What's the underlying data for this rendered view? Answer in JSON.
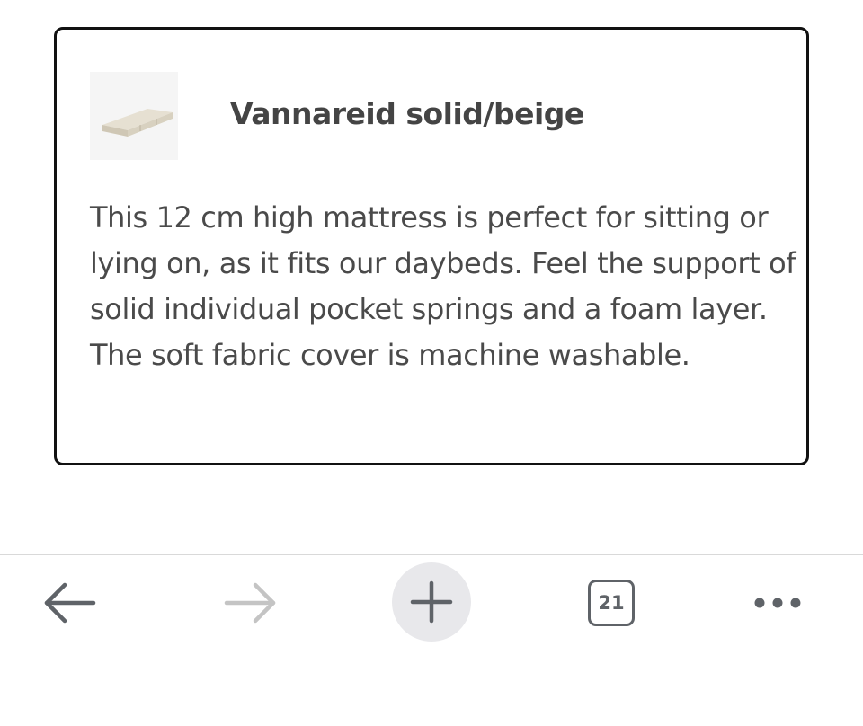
{
  "card": {
    "thumbnail_icon": "mattress-thumbnail",
    "title": "Vannareid solid/beige",
    "description": "This 12 cm high mattress is perfect for sitting or lying on, as it fits our daybeds. Feel the support of solid individual pocket springs and a foam layer. The soft fabric cover is machine washable."
  },
  "toolbar": {
    "back_icon": "back-arrow-icon",
    "forward_icon": "forward-arrow-icon",
    "new_tab_icon": "plus-icon",
    "tab_count": "21",
    "more_icon": "more-dots-icon"
  },
  "colors": {
    "icon_active": "#5f6368",
    "icon_disabled": "#c4c4c4",
    "new_tab_bg": "#e8e8eb",
    "text": "#4a4a4a"
  }
}
